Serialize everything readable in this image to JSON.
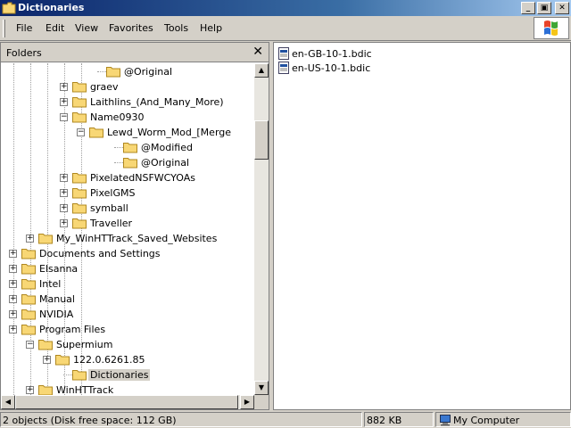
{
  "window": {
    "title": "Dictionaries"
  },
  "menu": [
    {
      "label": "File",
      "name": "menu-file"
    },
    {
      "label": "Edit",
      "name": "menu-edit"
    },
    {
      "label": "View",
      "name": "menu-view"
    },
    {
      "label": "Favorites",
      "name": "menu-favorites"
    },
    {
      "label": "Tools",
      "name": "menu-tools"
    },
    {
      "label": "Help",
      "name": "menu-help"
    }
  ],
  "folders_pane": {
    "header": "Folders",
    "close_glyph": "✕",
    "tree": [
      {
        "label": "@Original",
        "depth": 7,
        "expander": ""
      },
      {
        "label": "graev",
        "depth": 5,
        "expander": "+"
      },
      {
        "label": "Laithlins_(And_Many_More)",
        "depth": 5,
        "expander": "+"
      },
      {
        "label": "Name0930",
        "depth": 5,
        "expander": "-"
      },
      {
        "label": "Lewd_Worm_Mod_[Merge",
        "depth": 6,
        "expander": "-"
      },
      {
        "label": "@Modified",
        "depth": 8,
        "expander": ""
      },
      {
        "label": "@Original",
        "depth": 8,
        "expander": ""
      },
      {
        "label": "PixelatedNSFWCYOAs",
        "depth": 5,
        "expander": "+"
      },
      {
        "label": "PixelGMS",
        "depth": 5,
        "expander": "+"
      },
      {
        "label": "symball",
        "depth": 5,
        "expander": "+"
      },
      {
        "label": "Traveller",
        "depth": 5,
        "expander": "+"
      },
      {
        "label": "My_WinHTTrack_Saved_Websites",
        "depth": 3,
        "expander": "+"
      },
      {
        "label": "Documents and Settings",
        "depth": 2,
        "expander": "+"
      },
      {
        "label": "Elsanna",
        "depth": 2,
        "expander": "+"
      },
      {
        "label": "Intel",
        "depth": 2,
        "expander": "+"
      },
      {
        "label": "Manual",
        "depth": 2,
        "expander": "+"
      },
      {
        "label": "NVIDIA",
        "depth": 2,
        "expander": "+"
      },
      {
        "label": "Program Files",
        "depth": 2,
        "expander": "+"
      },
      {
        "label": "Supermium",
        "depth": 3,
        "expander": "-"
      },
      {
        "label": "122.0.6261.85",
        "depth": 4,
        "expander": "+"
      },
      {
        "label": "Dictionaries",
        "depth": 5,
        "expander": "",
        "selected": true
      },
      {
        "label": "WinHTTrack",
        "depth": 3,
        "expander": "+"
      }
    ]
  },
  "files": [
    {
      "name": "en-GB-10-1.bdic",
      "icon": "bdic-file-icon"
    },
    {
      "name": "en-US-10-1.bdic",
      "icon": "bdic-file-icon"
    }
  ],
  "status": {
    "objects": "2 objects (Disk free space: 112 GB)",
    "size": "882 KB",
    "zone": "My Computer"
  },
  "colors": {
    "titlebar_start": "#0a246a",
    "titlebar_end": "#a6caf0",
    "folder_fill": "#f8d775",
    "folder_stroke": "#b08820",
    "face": "#d4d0c8"
  }
}
